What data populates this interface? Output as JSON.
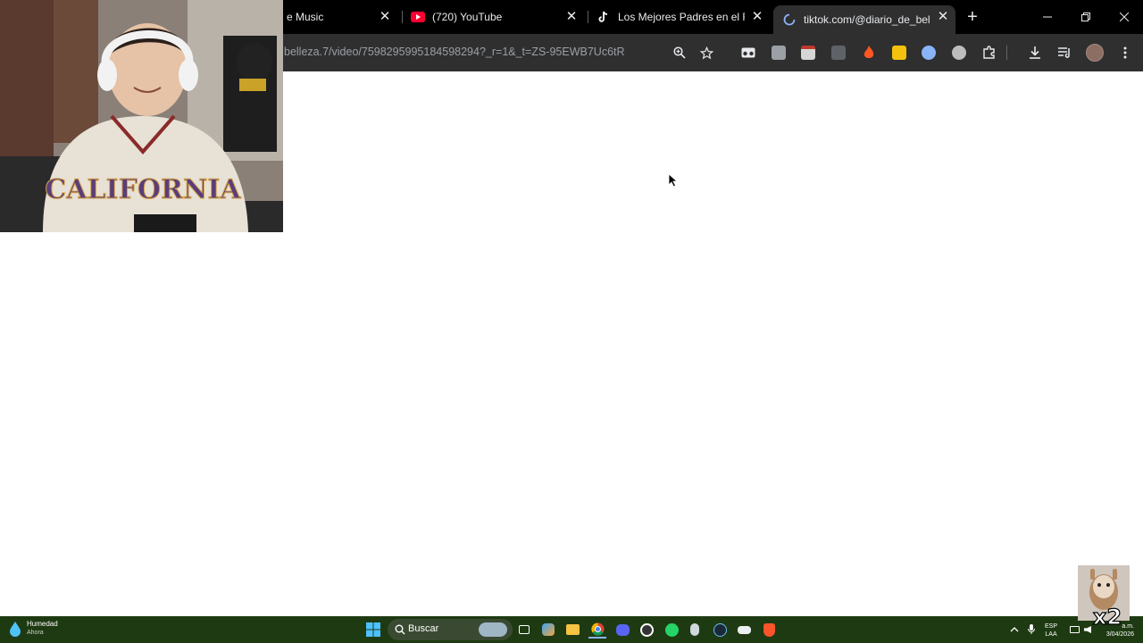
{
  "browser": {
    "tabs": [
      {
        "title": "e Music",
        "favicon": "music-icon",
        "active": false
      },
      {
        "title": "(720) YouTube",
        "favicon": "youtube-icon",
        "active": false
      },
      {
        "title": "Los Mejores Padres en el Re",
        "favicon": "tiktok-icon",
        "active": false
      },
      {
        "title": "tiktok.com/@diario_de_belle",
        "favicon": "loading-spinner-icon",
        "active": true
      }
    ],
    "new_tab_label": "+",
    "close_glyph": "✕",
    "url": "belleza.7/video/7598295995184598294?_r=1&_t=ZS-95EWB7Uc6tR",
    "colors": {
      "tabstrip": "#000000",
      "toolbar": "#2f2f2f",
      "page": "#ffffff"
    }
  },
  "taskbar": {
    "weather_title": "Humedad",
    "weather_subtitle": "Ahora",
    "search_label": "Buscar",
    "lang_top": "ESP",
    "lang_bottom": "LAA",
    "clock_time": "a.m.",
    "clock_date": "3/04/2026",
    "colors": {
      "background": "#1e3a12"
    }
  },
  "overlay": {
    "webcam_shirt_text": "CALIFORNIA",
    "sticker_text": "x2"
  }
}
